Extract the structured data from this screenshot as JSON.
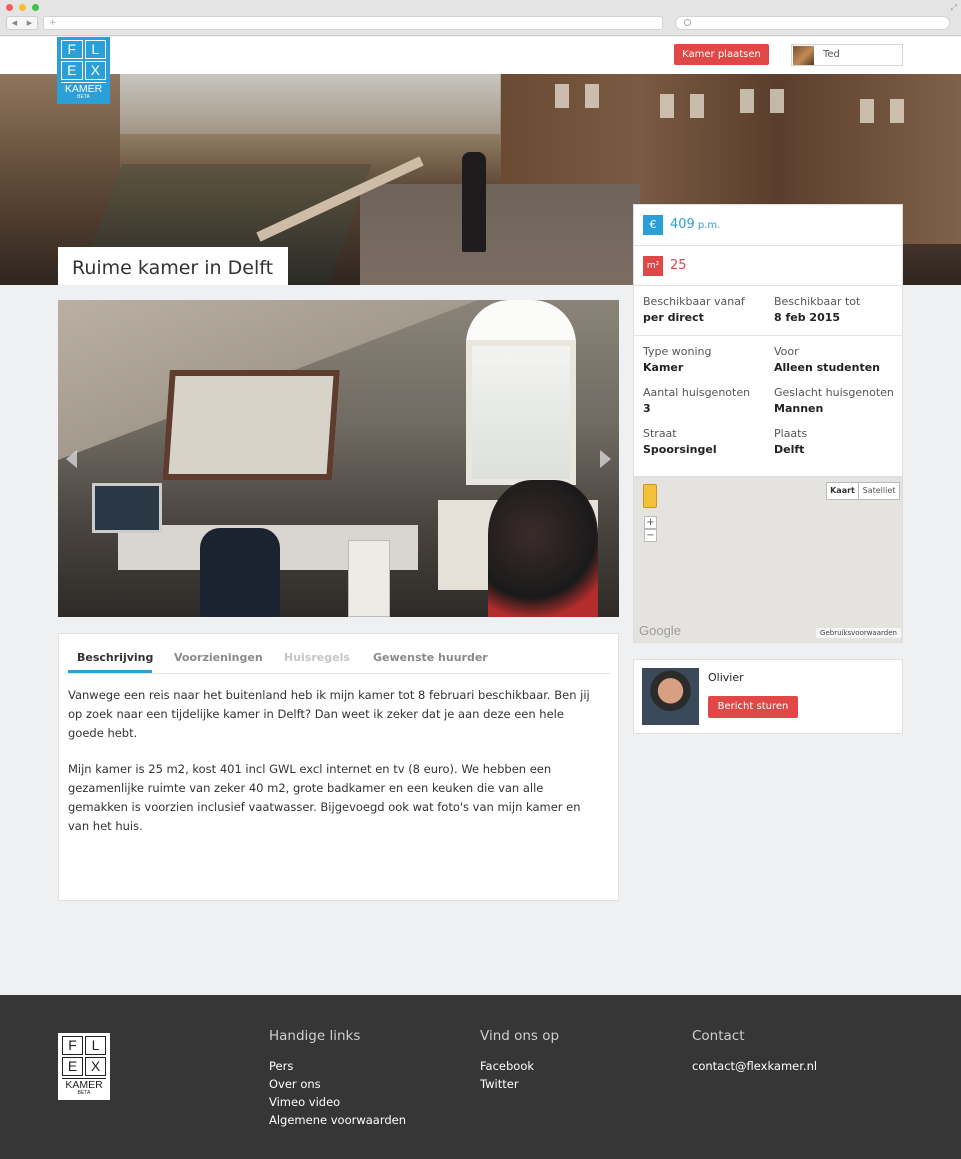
{
  "browser": {
    "url": "+",
    "nav_symbols": [
      "◀",
      "▶"
    ]
  },
  "logo": {
    "letters": [
      "F",
      "L",
      "E",
      "X"
    ],
    "word": "KAMER",
    "beta": "BETA"
  },
  "header": {
    "place_room_label": "Kamer plaatsen",
    "user_name": "Ted"
  },
  "listing": {
    "title": "Ruime kamer in Delft",
    "price_symbol": "€",
    "price": "409",
    "price_unit": "p.m.",
    "size_symbol": "m²",
    "size": "25",
    "details": [
      {
        "key": "Beschikbaar vanaf",
        "value": "per direct"
      },
      {
        "key": "Beschikbaar tot",
        "value": "8 feb 2015"
      },
      {
        "key": "Type woning",
        "value": "Kamer"
      },
      {
        "key": "Voor",
        "value": "Alleen studenten"
      },
      {
        "key": "Aantal huisgenoten",
        "value": "3"
      },
      {
        "key": "Geslacht huisgenoten",
        "value": "Mannen"
      },
      {
        "key": "Straat",
        "value": "Spoorsingel"
      },
      {
        "key": "Plaats",
        "value": "Delft"
      }
    ]
  },
  "map": {
    "type_map": "Kaart",
    "type_satellite": "Satelliet",
    "zoom_in": "+",
    "zoom_out": "−",
    "brand": "Google",
    "terms": "Gebruiksvoorwaarden"
  },
  "contact": {
    "name": "Olivier",
    "button": "Bericht sturen"
  },
  "tabs": [
    {
      "label": "Beschrijving"
    },
    {
      "label": "Voorzieningen"
    },
    {
      "label": "Huisregels"
    },
    {
      "label": "Gewenste huurder"
    }
  ],
  "description": {
    "paragraphs": [
      "Vanwege een reis naar het buitenland heb ik mijn kamer tot 8 februari beschikbaar. Ben jij op zoek naar een tijdelijke kamer in Delft? Dan weet ik zeker dat je aan deze een hele goede hebt.",
      "Mijn kamer is 25 m2, kost 401 incl GWL excl internet en tv (8 euro). We hebben een gezamenlijke ruimte van zeker 40 m2, grote badkamer en een keuken die van alle gemakken is voorzien inclusief vaatwasser. Bijgevoegd ook wat foto's van mijn kamer en van het huis."
    ]
  },
  "footer": {
    "links_title": "Handige links",
    "links": [
      "Pers",
      "Over ons",
      "Vimeo video",
      "Algemene voorwaarden"
    ],
    "social_title": "Vind ons op",
    "social": [
      "Facebook",
      "Twitter"
    ],
    "contact_title": "Contact",
    "contact_email": "contact@flexkamer.nl"
  },
  "colors": {
    "brand_blue": "#2a9fd8",
    "accent_red": "#e04848",
    "footer_bg": "#363636"
  }
}
